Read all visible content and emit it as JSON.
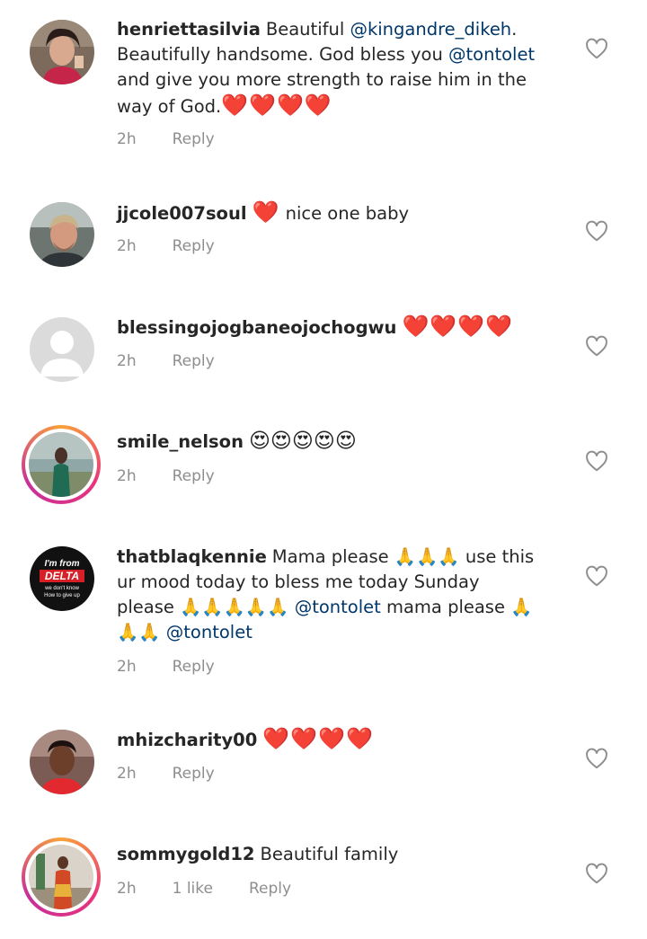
{
  "comments": [
    {
      "username": "henriettasilvia",
      "p1": "Beautiful ",
      "m1": "@kingandre_dikeh",
      "p2": ". Beautifully handsome.  God bless you ",
      "m2": "@tontolet",
      "p3": "  and give you more strength to raise him in the way of God.",
      "hearts": "❤️❤️❤️❤️",
      "time": "2h",
      "reply": "Reply"
    },
    {
      "username": "jjcole007soul",
      "hearts": "❤️",
      "p1": " nice one baby",
      "time": "2h",
      "reply": "Reply"
    },
    {
      "username": "blessingojogbaneojochogwu",
      "hearts": "❤️❤️❤️❤️",
      "time": "2h",
      "reply": "Reply"
    },
    {
      "username": "smile_nelson",
      "emojis": "😍😍😍😍😍",
      "time": "2h",
      "reply": "Reply"
    },
    {
      "username": "thatblaqkennie",
      "p1": "Mama please 🙏🙏🙏 use this ur mood today to bless me today Sunday please 🙏🙏🙏🙏🙏 ",
      "m1": "@tontolet",
      "p2": " mama please 🙏🙏🙏 ",
      "m2": "@tontolet",
      "time": "2h",
      "reply": "Reply",
      "avatar_text": {
        "line1": "I'm from",
        "line2": "DELTA",
        "line3": "we don't know",
        "line4": "How to give up"
      }
    },
    {
      "username": "mhizcharity00",
      "hearts": "❤️❤️❤️❤️",
      "time": "2h",
      "reply": "Reply"
    },
    {
      "username": "sommygold12",
      "p1": "Beautiful family",
      "time": "2h",
      "likes": "1 like",
      "reply": "Reply"
    }
  ],
  "colors": {
    "text": "#262626",
    "mention": "#00376b",
    "meta": "#8e8e8e",
    "heart": "#e0152b"
  },
  "icons": {
    "like": "heart-outline-icon"
  }
}
